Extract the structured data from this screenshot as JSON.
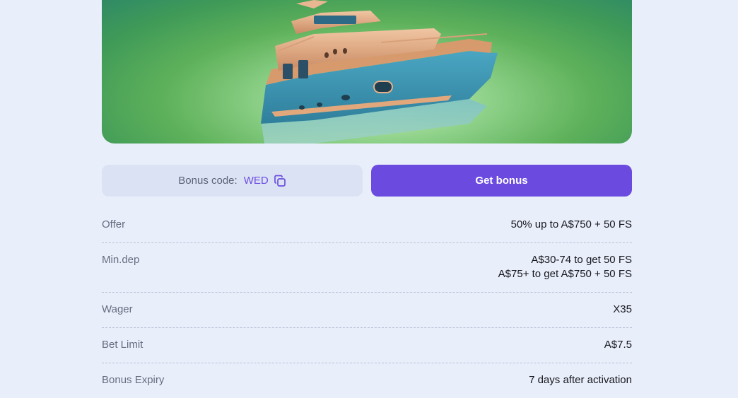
{
  "hero": {
    "image_alt": "boat illustration",
    "colors": {
      "bg_light": "#cfeec0",
      "bg_dark": "#2f8a66",
      "hull": "#3a94b0",
      "cabin": "#d89a72"
    }
  },
  "bonus_code": {
    "label": "Bonus code:",
    "value": "WED",
    "icon": "copy-icon"
  },
  "get_bonus": {
    "label": "Get bonus",
    "color": "#6b4ae0"
  },
  "details": [
    {
      "label": "Offer",
      "values": [
        "50% up to A$750 + 50 FS"
      ]
    },
    {
      "label": "Min.dep",
      "values": [
        "A$30-74 to get 50 FS",
        "A$75+ to get A$750 + 50 FS"
      ]
    },
    {
      "label": "Wager",
      "values": [
        "X35"
      ]
    },
    {
      "label": "Bet Limit",
      "values": [
        "A$7.5"
      ]
    },
    {
      "label": "Bonus Expiry",
      "values": [
        "7 days after activation"
      ]
    }
  ]
}
